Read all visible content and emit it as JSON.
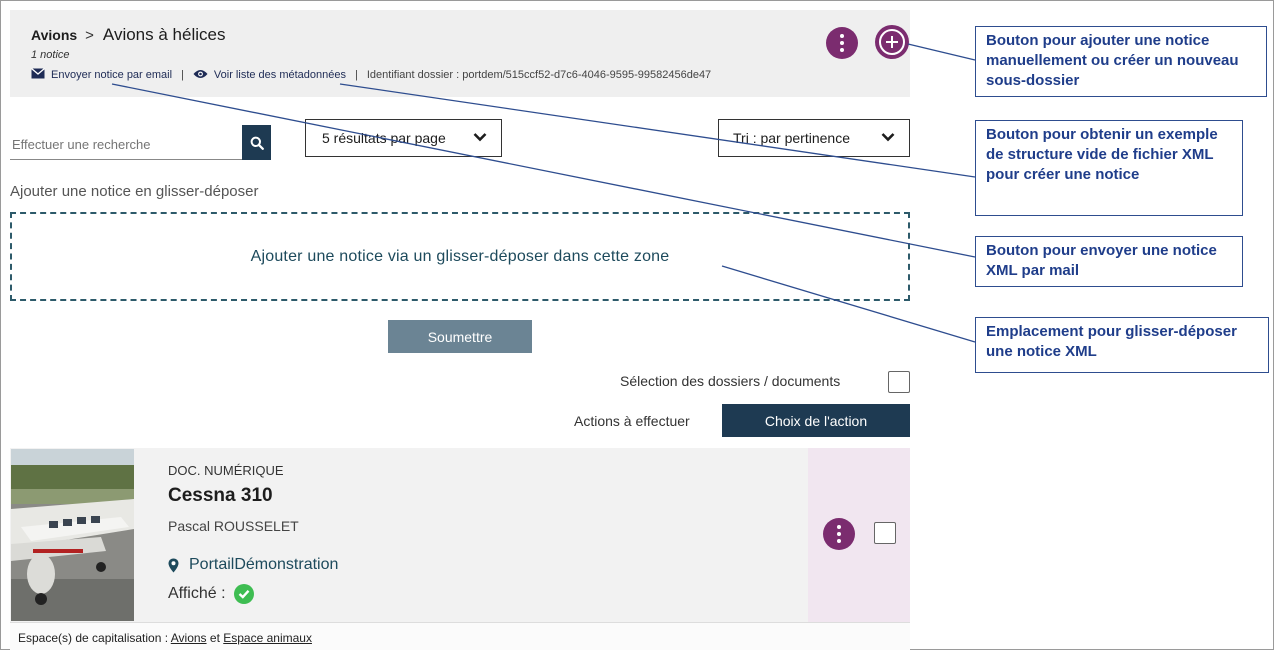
{
  "header": {
    "breadcrumb_root": "Avions",
    "breadcrumb_current": "Avions à hélices",
    "count": "1 notice",
    "email_link": "Envoyer notice par email",
    "metadata_link": "Voir liste des métadonnées",
    "identifier": "Identifiant dossier : portdem/515ccf52-d7c6-4046-9595-99582456de47"
  },
  "toolbar": {
    "search_placeholder": "Effectuer une recherche",
    "per_page": "5 résultats par page",
    "sort": "Tri : par pertinence"
  },
  "dropzone": {
    "label": "Ajouter une notice en glisser-déposer",
    "text": "Ajouter une notice via un glisser-déposer dans cette zone",
    "submit": "Soumettre"
  },
  "selection": {
    "label": "Sélection des dossiers / documents",
    "actions_label": "Actions à effectuer",
    "actions_button": "Choix de l'action"
  },
  "result": {
    "type": "DOC. NUMÉRIQUE",
    "title": "Cessna 310",
    "author": "Pascal ROUSSELET",
    "portal": "PortailDémonstration",
    "shown_label": "Affiché :",
    "spaces_prefix": "Espace(s) de capitalisation : ",
    "space1": "Avions",
    "space_join": " et ",
    "space2": "Espace animaux"
  },
  "callouts": {
    "add": "Bouton pour ajouter une notice manuellement ou créer un nouveau sous-dossier",
    "xml_template": "Bouton pour obtenir un exemple de structure vide de fichier XML pour créer une notice",
    "send_mail": "Bouton pour envoyer une notice XML par mail",
    "drop_area": "Emplacement pour glisser-déposer une notice XML"
  },
  "colors": {
    "accent_purple": "#7b2c6f",
    "dark_navy": "#1e3a52",
    "callout_blue": "#2e4d8f",
    "success_green": "#3ebd52"
  }
}
